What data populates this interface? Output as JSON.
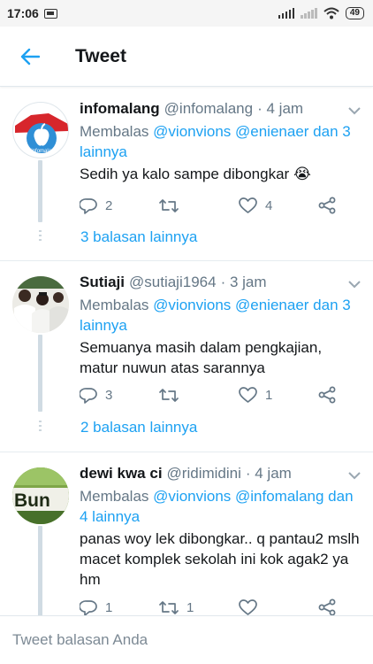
{
  "status_bar": {
    "time": "17:06",
    "battery": "49",
    "icons": [
      "notification-icon",
      "signal-icon",
      "signal-off-icon",
      "wifi-icon",
      "battery-icon"
    ]
  },
  "header": {
    "title": "Tweet",
    "back_icon": "arrow-left-icon"
  },
  "replies": [
    {
      "name": "infomalang",
      "handle": "@infomalang",
      "time": "· 4 jam",
      "reply_prefix": "Membalas",
      "reply_mentions": "@vionvions @enienaer dan 3 lainnya",
      "text": "Sedih ya kalo sampe dibongkar",
      "emoji": "😭",
      "avatar_label": "@infomalang",
      "replies_count": "2",
      "retweets_count": "",
      "likes_count": "4",
      "more_replies": "3 balasan lainnya"
    },
    {
      "name": "Sutiaji",
      "handle": "@sutiaji1964",
      "time": "· 3 jam",
      "reply_prefix": "Membalas",
      "reply_mentions": "@vionvions @enienaer dan 3 lainnya",
      "text": "Semuanya masih dalam pengkajian, matur nuwun atas sarannya",
      "replies_count": "3",
      "retweets_count": "",
      "likes_count": "1",
      "more_replies": "2 balasan lainnya"
    },
    {
      "name": "dewi kwa ci",
      "handle": "@ridimidini",
      "time": "· 4 jam",
      "reply_prefix": "Membalas",
      "reply_mentions": "@vionvions @infomalang dan 4 lainnya",
      "text": "panas woy lek dibongkar.. q pantau2 mslh macet komplek sekolah ini kok agak2 ya hm",
      "avatar_label": "Bun",
      "replies_count": "1",
      "retweets_count": "1",
      "likes_count": ""
    }
  ],
  "compose": {
    "placeholder": "Tweet balasan Anda"
  },
  "colors": {
    "accent": "#1da1f2",
    "secondary_text": "#657786",
    "primary_text": "#14171a",
    "divider": "#e6ecf0"
  }
}
